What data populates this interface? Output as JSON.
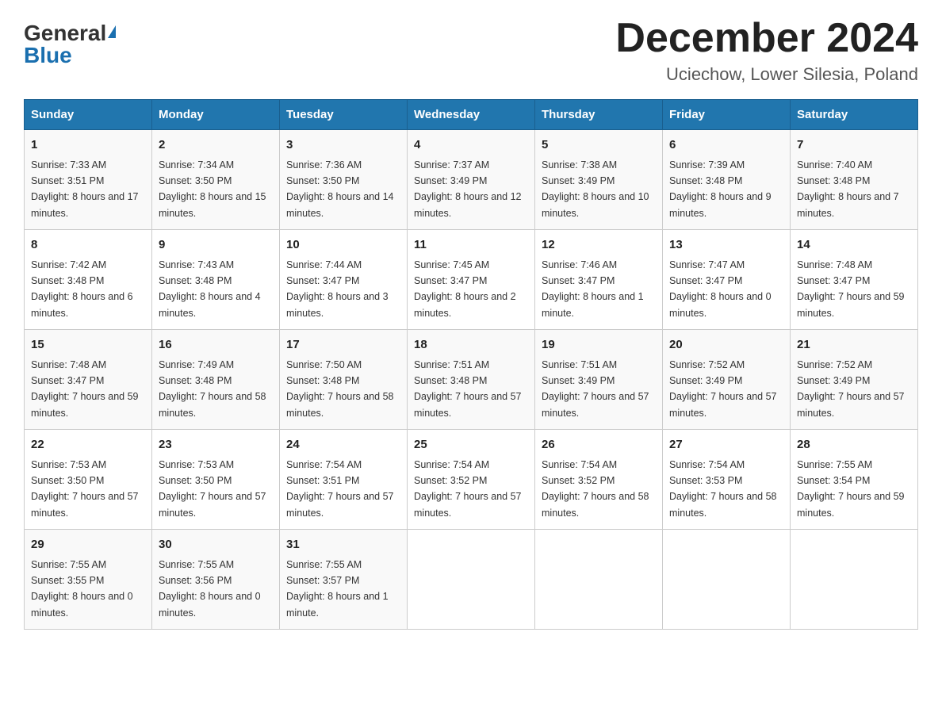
{
  "logo": {
    "general": "General",
    "blue": "Blue"
  },
  "title": "December 2024",
  "location": "Uciechow, Lower Silesia, Poland",
  "days_of_week": [
    "Sunday",
    "Monday",
    "Tuesday",
    "Wednesday",
    "Thursday",
    "Friday",
    "Saturday"
  ],
  "weeks": [
    [
      {
        "day": "1",
        "sunrise": "7:33 AM",
        "sunset": "3:51 PM",
        "daylight": "8 hours and 17 minutes."
      },
      {
        "day": "2",
        "sunrise": "7:34 AM",
        "sunset": "3:50 PM",
        "daylight": "8 hours and 15 minutes."
      },
      {
        "day": "3",
        "sunrise": "7:36 AM",
        "sunset": "3:50 PM",
        "daylight": "8 hours and 14 minutes."
      },
      {
        "day": "4",
        "sunrise": "7:37 AM",
        "sunset": "3:49 PM",
        "daylight": "8 hours and 12 minutes."
      },
      {
        "day": "5",
        "sunrise": "7:38 AM",
        "sunset": "3:49 PM",
        "daylight": "8 hours and 10 minutes."
      },
      {
        "day": "6",
        "sunrise": "7:39 AM",
        "sunset": "3:48 PM",
        "daylight": "8 hours and 9 minutes."
      },
      {
        "day": "7",
        "sunrise": "7:40 AM",
        "sunset": "3:48 PM",
        "daylight": "8 hours and 7 minutes."
      }
    ],
    [
      {
        "day": "8",
        "sunrise": "7:42 AM",
        "sunset": "3:48 PM",
        "daylight": "8 hours and 6 minutes."
      },
      {
        "day": "9",
        "sunrise": "7:43 AM",
        "sunset": "3:48 PM",
        "daylight": "8 hours and 4 minutes."
      },
      {
        "day": "10",
        "sunrise": "7:44 AM",
        "sunset": "3:47 PM",
        "daylight": "8 hours and 3 minutes."
      },
      {
        "day": "11",
        "sunrise": "7:45 AM",
        "sunset": "3:47 PM",
        "daylight": "8 hours and 2 minutes."
      },
      {
        "day": "12",
        "sunrise": "7:46 AM",
        "sunset": "3:47 PM",
        "daylight": "8 hours and 1 minute."
      },
      {
        "day": "13",
        "sunrise": "7:47 AM",
        "sunset": "3:47 PM",
        "daylight": "8 hours and 0 minutes."
      },
      {
        "day": "14",
        "sunrise": "7:48 AM",
        "sunset": "3:47 PM",
        "daylight": "7 hours and 59 minutes."
      }
    ],
    [
      {
        "day": "15",
        "sunrise": "7:48 AM",
        "sunset": "3:47 PM",
        "daylight": "7 hours and 59 minutes."
      },
      {
        "day": "16",
        "sunrise": "7:49 AM",
        "sunset": "3:48 PM",
        "daylight": "7 hours and 58 minutes."
      },
      {
        "day": "17",
        "sunrise": "7:50 AM",
        "sunset": "3:48 PM",
        "daylight": "7 hours and 58 minutes."
      },
      {
        "day": "18",
        "sunrise": "7:51 AM",
        "sunset": "3:48 PM",
        "daylight": "7 hours and 57 minutes."
      },
      {
        "day": "19",
        "sunrise": "7:51 AM",
        "sunset": "3:49 PM",
        "daylight": "7 hours and 57 minutes."
      },
      {
        "day": "20",
        "sunrise": "7:52 AM",
        "sunset": "3:49 PM",
        "daylight": "7 hours and 57 minutes."
      },
      {
        "day": "21",
        "sunrise": "7:52 AM",
        "sunset": "3:49 PM",
        "daylight": "7 hours and 57 minutes."
      }
    ],
    [
      {
        "day": "22",
        "sunrise": "7:53 AM",
        "sunset": "3:50 PM",
        "daylight": "7 hours and 57 minutes."
      },
      {
        "day": "23",
        "sunrise": "7:53 AM",
        "sunset": "3:50 PM",
        "daylight": "7 hours and 57 minutes."
      },
      {
        "day": "24",
        "sunrise": "7:54 AM",
        "sunset": "3:51 PM",
        "daylight": "7 hours and 57 minutes."
      },
      {
        "day": "25",
        "sunrise": "7:54 AM",
        "sunset": "3:52 PM",
        "daylight": "7 hours and 57 minutes."
      },
      {
        "day": "26",
        "sunrise": "7:54 AM",
        "sunset": "3:52 PM",
        "daylight": "7 hours and 58 minutes."
      },
      {
        "day": "27",
        "sunrise": "7:54 AM",
        "sunset": "3:53 PM",
        "daylight": "7 hours and 58 minutes."
      },
      {
        "day": "28",
        "sunrise": "7:55 AM",
        "sunset": "3:54 PM",
        "daylight": "7 hours and 59 minutes."
      }
    ],
    [
      {
        "day": "29",
        "sunrise": "7:55 AM",
        "sunset": "3:55 PM",
        "daylight": "8 hours and 0 minutes."
      },
      {
        "day": "30",
        "sunrise": "7:55 AM",
        "sunset": "3:56 PM",
        "daylight": "8 hours and 0 minutes."
      },
      {
        "day": "31",
        "sunrise": "7:55 AM",
        "sunset": "3:57 PM",
        "daylight": "8 hours and 1 minute."
      },
      null,
      null,
      null,
      null
    ]
  ],
  "labels": {
    "sunrise": "Sunrise:",
    "sunset": "Sunset:",
    "daylight": "Daylight:"
  }
}
